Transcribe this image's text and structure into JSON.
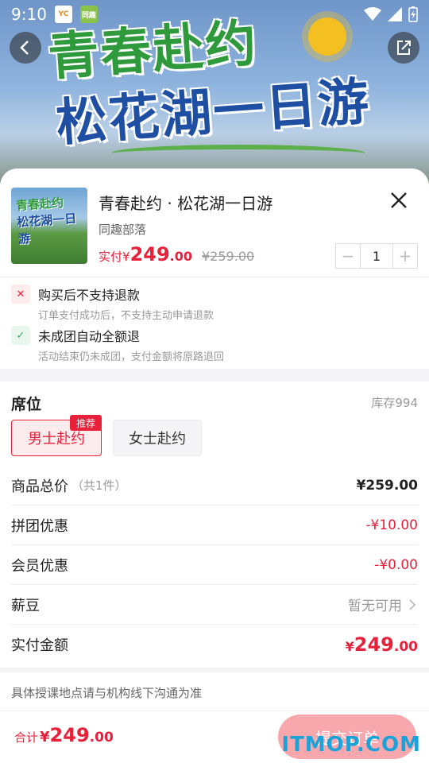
{
  "status": {
    "time": "9:10",
    "app1": "YC",
    "app2": "同趣"
  },
  "hero": {
    "line1": "青春赴约",
    "line2": "松花湖一日游"
  },
  "product": {
    "title": "青春赴约 · 松花湖一日游",
    "org": "同趣部落",
    "pay_label": "实付",
    "pay_currency": "¥",
    "pay_int": "249",
    "pay_dec": ".00",
    "original_price": "¥259.00",
    "quantity": "1",
    "thumb_line1": "青春赴约",
    "thumb_line2": "松花湖一日游"
  },
  "policies": [
    {
      "title": "购买后不支持退款",
      "sub": "订单支付成功后，不支持主动申请退款",
      "icon": "x-icon"
    },
    {
      "title": "未成团自动全额退",
      "sub": "活动结束仍未成团，支付金额将原路退回",
      "icon": "check-icon"
    }
  ],
  "seat": {
    "title": "席位",
    "stock": "库存994",
    "options": [
      "男士赴约",
      "女士赴约"
    ],
    "badge": "推荐"
  },
  "rows": {
    "total_label": "商品总价",
    "total_sub": "（共1件）",
    "total_value": "¥259.00",
    "group_label": "拼团优惠",
    "group_value": "-¥10.00",
    "member_label": "会员优惠",
    "member_value": "-¥0.00",
    "bean_label": "薪豆",
    "bean_value": "暂无可用",
    "pay_label": "实付金额",
    "pay_cur": "¥",
    "pay_int": "249",
    "pay_dec": ".00"
  },
  "note": "具体授课地点请与机构线下沟通为准",
  "bottom": {
    "sum_label": "合计",
    "cur": "¥",
    "int": "249",
    "dec": ".00",
    "submit": "提交订单",
    "watermark": "ITMOP.COM"
  },
  "colors": {
    "accent": "#e8203a",
    "green": "#2fae61",
    "submit_bg": "#f8a7ad"
  }
}
